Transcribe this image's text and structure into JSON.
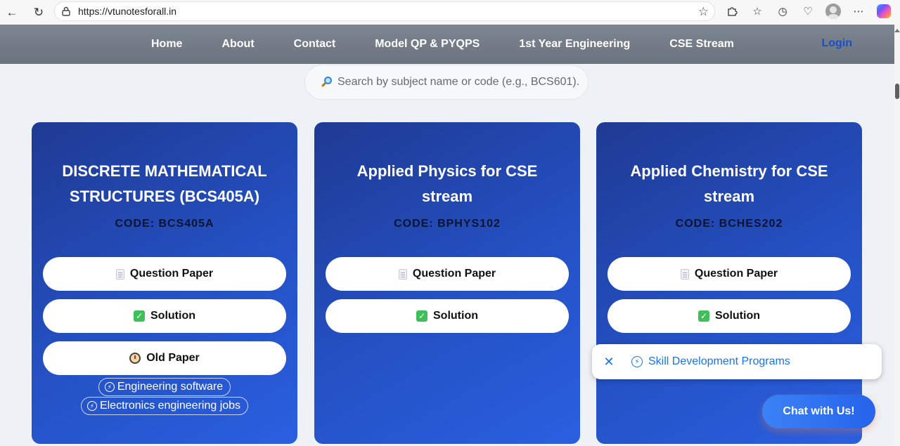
{
  "browser": {
    "url": "https://vtunotesforall.in"
  },
  "nav": {
    "links": [
      "Home",
      "About",
      "Contact",
      "Model QP & PYQPS",
      "1st Year Engineering",
      "CSE Stream"
    ],
    "login": "Login"
  },
  "search": {
    "placeholder": "Search by subject name or code (e.g., BCS601)."
  },
  "cards": [
    {
      "title": "DISCRETE MATHEMATICAL STRUCTURES (BCS405A)",
      "code": "CODE: BCS405A",
      "buttons": [
        {
          "label": "Question Paper",
          "icon": "document-icon"
        },
        {
          "label": "Solution",
          "icon": "check-icon"
        },
        {
          "label": "Old Paper",
          "icon": "clock-icon"
        }
      ],
      "ads": [
        "Engineering software",
        "Electronics engineering jobs"
      ]
    },
    {
      "title": "Applied Physics for CSE stream",
      "code": "CODE: BPHYS102",
      "buttons": [
        {
          "label": "Question Paper",
          "icon": "document-icon"
        },
        {
          "label": "Solution",
          "icon": "check-icon"
        }
      ]
    },
    {
      "title": "Applied Chemistry for CSE stream",
      "code": "CODE: BCHES202",
      "buttons": [
        {
          "label": "Question Paper",
          "icon": "document-icon"
        },
        {
          "label": "Solution",
          "icon": "check-icon"
        }
      ]
    }
  ],
  "popup": {
    "text": "Skill Development Programs"
  },
  "chat": {
    "label": "Chat with Us!"
  },
  "colors": {
    "card": "#2451c4",
    "nav": "#7d8591",
    "accent": "#1a73e8"
  }
}
